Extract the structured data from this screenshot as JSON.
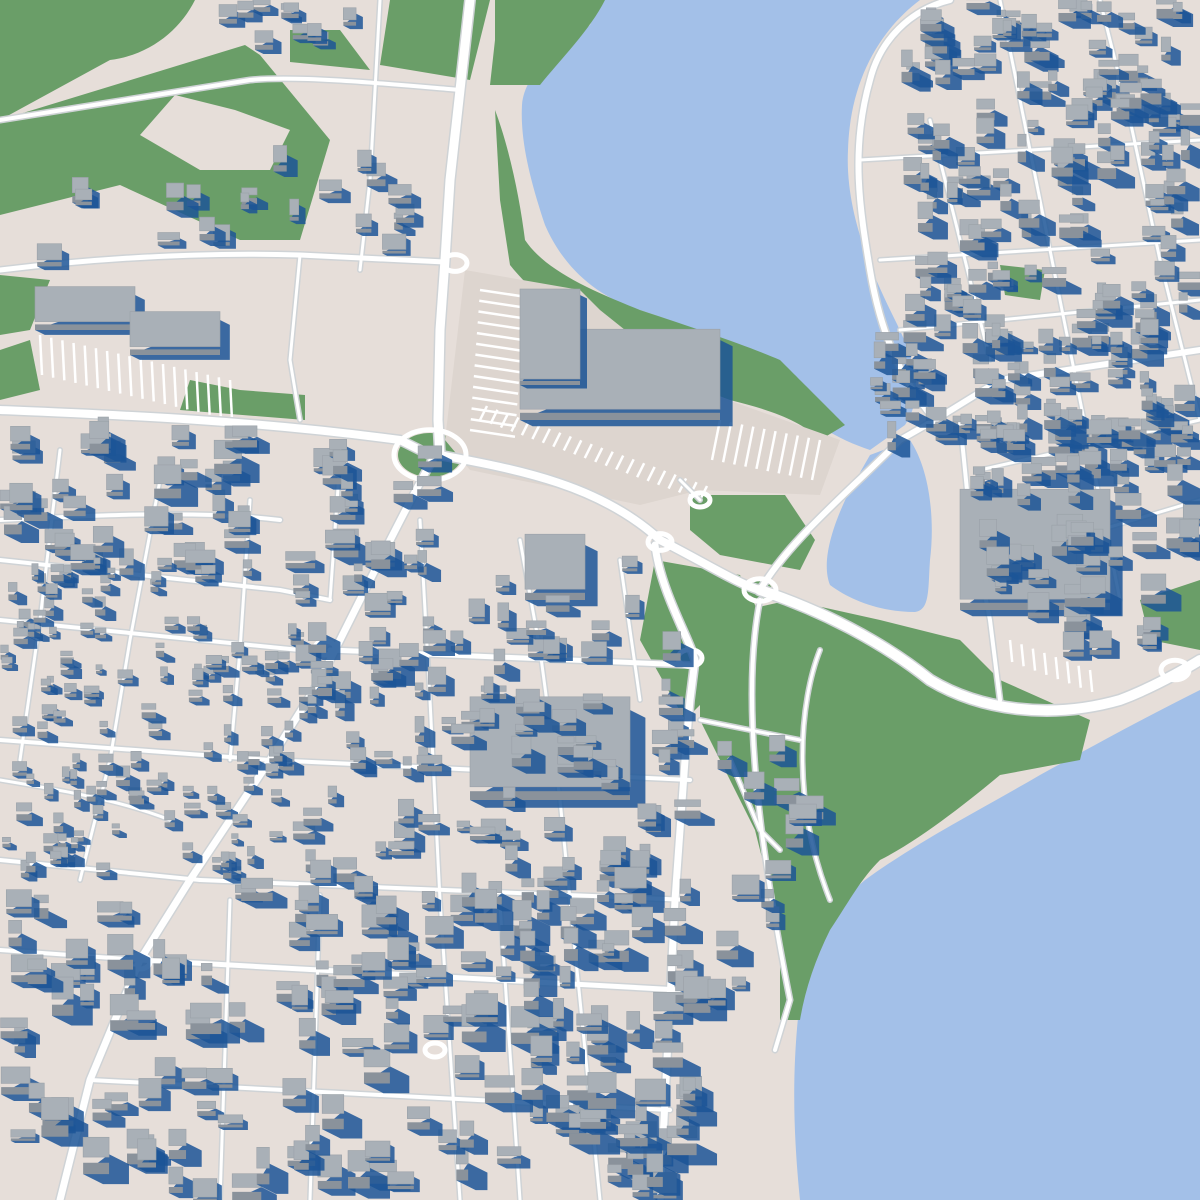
{
  "map": {
    "style": "3d-isometric-city-model",
    "labels_visible": false,
    "colors": {
      "land": "#e6ded9",
      "water": "#a3c0e8",
      "park": "#6a9e68",
      "road": "#ffffff",
      "road_edge": "#cfd3d6",
      "building_top": "#a9b0b7",
      "building_side": "#8a929b",
      "building_shadow": "#1c5597",
      "parking_line": "#ffffff"
    },
    "features": {
      "water_bodies": [
        "lake",
        "bay",
        "pond",
        "pond"
      ],
      "parks": [
        "park",
        "park",
        "park",
        "park",
        "park",
        "park",
        "park",
        "roundabout-green",
        "roundabout-green"
      ],
      "roundabouts": 9,
      "building_districts": [
        "downtown-west",
        "downtown-south",
        "east-peninsula",
        "north-suburb"
      ],
      "large_structures": [
        "shopping-mall",
        "warehouse",
        "warehouse",
        "arena",
        "campus"
      ]
    }
  }
}
